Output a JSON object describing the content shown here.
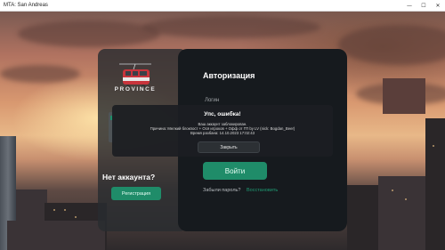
{
  "window": {
    "title": "MTA: San Andreas",
    "controls": [
      "minimize-icon",
      "maximize-icon",
      "close-icon"
    ],
    "minimize_glyph": "—",
    "maximize_glyph": "☐",
    "close_glyph": "✕"
  },
  "brand": {
    "name": "PROVINCE"
  },
  "left_panel": {
    "no_account": "Нет аккаунта?",
    "register_label": "Регистрация"
  },
  "auth": {
    "title": "Авторизация",
    "login_label": "Логин",
    "login_button": "Войти",
    "forgot_password": "Забыли пароль?",
    "restore_link": "Восстановить"
  },
  "modal": {
    "title": "Упс, ошибка!",
    "line1": "Ваш аккаунт заблокирован.",
    "line2": "Причина: Мелкий блокпост + Ося игроков + Офф от ГП by LV (nick: Bogdan_Beer)",
    "line3": "Время разбана: 14.10.2023 17:02:43",
    "close_label": "Закрыть"
  },
  "colors": {
    "accent": "#1f8c69",
    "panel": "#161a1e",
    "modal": "#1c1e22"
  }
}
